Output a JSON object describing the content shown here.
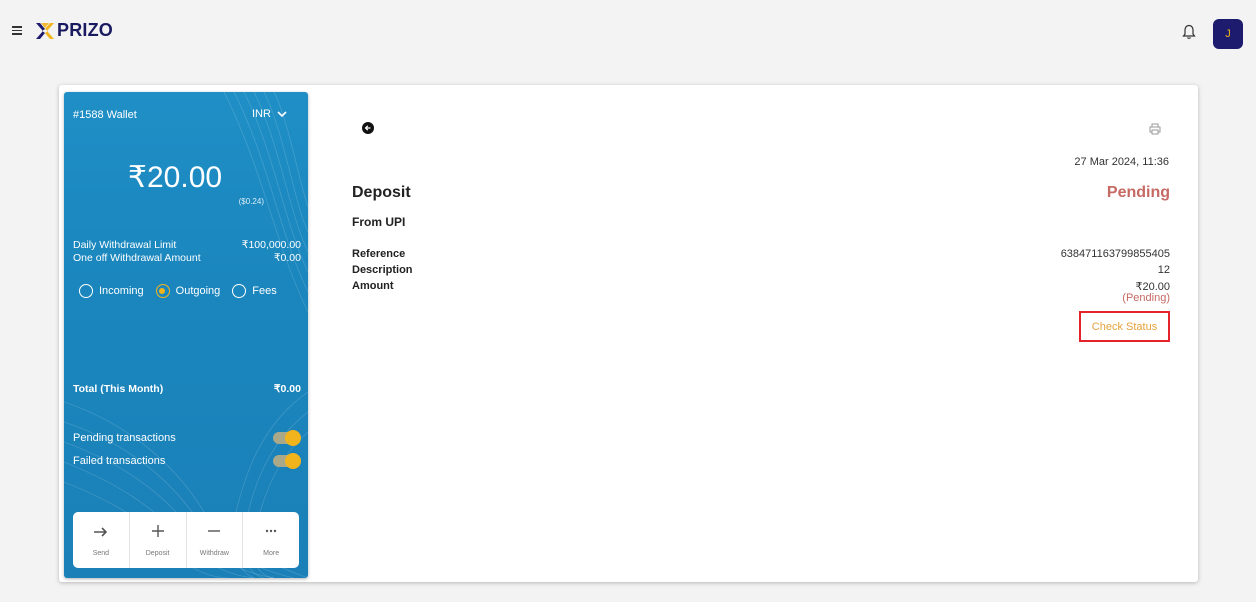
{
  "header": {
    "brand": "PRIZO",
    "avatar_initial": "J"
  },
  "wallet": {
    "title": "#1588 Wallet",
    "currency": "INR",
    "balance": "₹20.00",
    "balance_usd": "($0.24)",
    "limits": [
      {
        "label": "Daily Withdrawal Limit",
        "value": "₹100,000.00"
      },
      {
        "label": "One off Withdrawal Amount",
        "value": "₹0.00"
      }
    ],
    "filters": [
      {
        "label": "Incoming",
        "selected": false
      },
      {
        "label": "Outgoing",
        "selected": true
      },
      {
        "label": "Fees",
        "selected": false
      }
    ],
    "total_label": "Total (This Month)",
    "total_value": "₹0.00",
    "toggles": [
      {
        "label": "Pending transactions",
        "on": true
      },
      {
        "label": "Failed transactions",
        "on": true
      }
    ],
    "actions": [
      {
        "label": "Send",
        "icon": "arrow-right-icon"
      },
      {
        "label": "Deposit",
        "icon": "plus-icon"
      },
      {
        "label": "Withdraw",
        "icon": "minus-icon"
      },
      {
        "label": "More",
        "icon": "more-dots-icon"
      }
    ]
  },
  "detail": {
    "timestamp": "27 Mar 2024, 11:36",
    "title": "Deposit",
    "status": "Pending",
    "source": "From UPI",
    "fields": [
      {
        "label": "Reference",
        "value": "638471163799855405"
      },
      {
        "label": "Description",
        "value": "12"
      },
      {
        "label": "Amount",
        "value": "₹20.00"
      }
    ],
    "amount_status": "(Pending)",
    "check_status_label": "Check Status"
  },
  "colors": {
    "accent_yellow": "#f2b41c",
    "brand_navy": "#1d1b6e",
    "wallet_blue": "#1b86bd",
    "pending_red": "#c66a63",
    "highlight_red": "#e6232a"
  }
}
